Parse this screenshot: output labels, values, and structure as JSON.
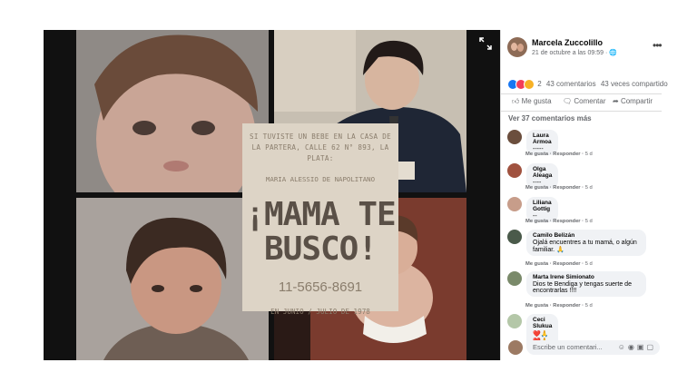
{
  "flyer": {
    "intro": "SI TUVISTE UN BEBE EN LA CASA DE LA PARTERA, CALLE 62 N° 893, LA PLATA:",
    "name": "MARIA ALESSIO DE NAPOLITANO",
    "headline_1": "¡MAMA TE",
    "headline_2": "BUSCO!",
    "phone": "11-5656-8691",
    "when": "EN JUNIO / JULIO DE 1978"
  },
  "post": {
    "author": "Marcela Zuccolillo",
    "date": "21 de octubre a las 09:59 · ",
    "globe_icon": "globe-icon",
    "reactions_count": "2",
    "comments_count": "43 comentarios",
    "shares_count": "43 veces compartido",
    "actions": {
      "like": "Me gusta",
      "comment": "Comentar",
      "share": "Compartir"
    },
    "view_more": "Ver 37 comentarios más"
  },
  "comments": [
    {
      "author": "Laura Armoa",
      "text": "-----",
      "avatar_color": "#6b4e3d"
    },
    {
      "author": "Olga Aleaga",
      "text": "----",
      "avatar_color": "#a0523f"
    },
    {
      "author": "Liliana Gottig",
      "text": "--",
      "avatar_color": "#c79d8a"
    },
    {
      "author": "Camilo Belizán",
      "text": "Ojalá encuentres a tu mamá, o algún familiar. 🙏",
      "avatar_color": "#4a5a4a"
    },
    {
      "author": "Marta Irene Simionato",
      "text": "Dios te Bendiga y tengas suerte de encontrarlas !!!!",
      "avatar_color": "#7a8a6a"
    },
    {
      "author": "Ceci Slukua",
      "text": "❤️🙏❤️🙏❤️",
      "avatar_color": "#b4c7a8"
    }
  ],
  "comment_actions": {
    "like": "Me gusta",
    "reply": "Responder",
    "time": "5 d"
  },
  "write": {
    "placeholder": "Escribe un comentari..."
  },
  "colors": {
    "like_blue": "#1877f2",
    "love_red": "#f33e58",
    "card_bg": "#ddd4c6"
  }
}
